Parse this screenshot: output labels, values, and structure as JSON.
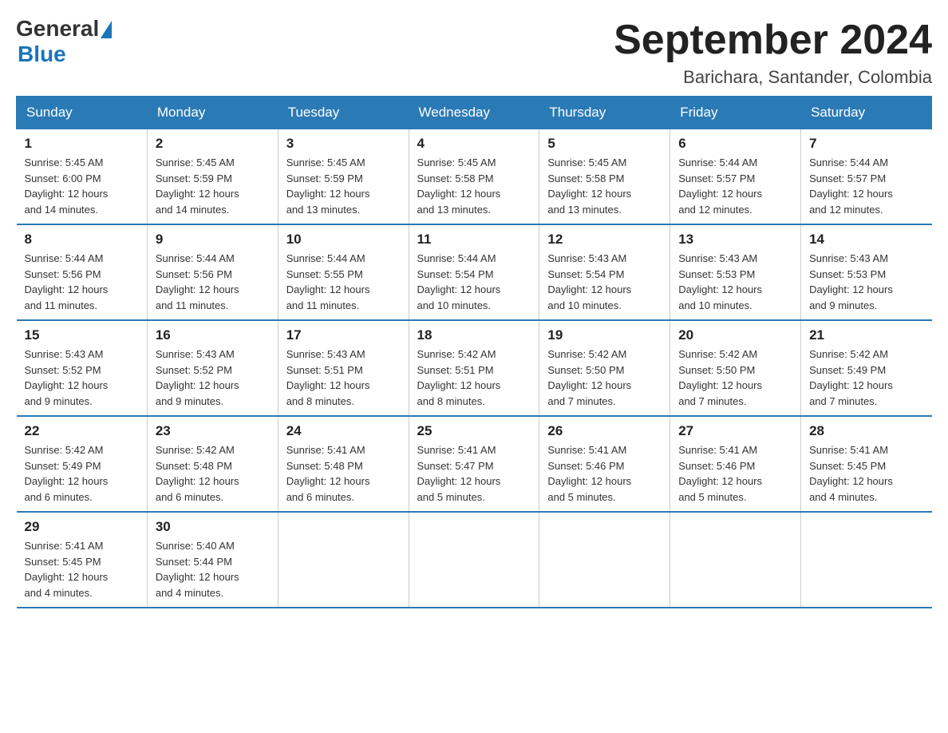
{
  "logo": {
    "general": "General",
    "blue": "Blue"
  },
  "header": {
    "title": "September 2024",
    "subtitle": "Barichara, Santander, Colombia"
  },
  "weekdays": [
    "Sunday",
    "Monday",
    "Tuesday",
    "Wednesday",
    "Thursday",
    "Friday",
    "Saturday"
  ],
  "weeks": [
    [
      {
        "day": "1",
        "sunrise": "5:45 AM",
        "sunset": "6:00 PM",
        "daylight": "12 hours and 14 minutes."
      },
      {
        "day": "2",
        "sunrise": "5:45 AM",
        "sunset": "5:59 PM",
        "daylight": "12 hours and 14 minutes."
      },
      {
        "day": "3",
        "sunrise": "5:45 AM",
        "sunset": "5:59 PM",
        "daylight": "12 hours and 13 minutes."
      },
      {
        "day": "4",
        "sunrise": "5:45 AM",
        "sunset": "5:58 PM",
        "daylight": "12 hours and 13 minutes."
      },
      {
        "day": "5",
        "sunrise": "5:45 AM",
        "sunset": "5:58 PM",
        "daylight": "12 hours and 13 minutes."
      },
      {
        "day": "6",
        "sunrise": "5:44 AM",
        "sunset": "5:57 PM",
        "daylight": "12 hours and 12 minutes."
      },
      {
        "day": "7",
        "sunrise": "5:44 AM",
        "sunset": "5:57 PM",
        "daylight": "12 hours and 12 minutes."
      }
    ],
    [
      {
        "day": "8",
        "sunrise": "5:44 AM",
        "sunset": "5:56 PM",
        "daylight": "12 hours and 11 minutes."
      },
      {
        "day": "9",
        "sunrise": "5:44 AM",
        "sunset": "5:56 PM",
        "daylight": "12 hours and 11 minutes."
      },
      {
        "day": "10",
        "sunrise": "5:44 AM",
        "sunset": "5:55 PM",
        "daylight": "12 hours and 11 minutes."
      },
      {
        "day": "11",
        "sunrise": "5:44 AM",
        "sunset": "5:54 PM",
        "daylight": "12 hours and 10 minutes."
      },
      {
        "day": "12",
        "sunrise": "5:43 AM",
        "sunset": "5:54 PM",
        "daylight": "12 hours and 10 minutes."
      },
      {
        "day": "13",
        "sunrise": "5:43 AM",
        "sunset": "5:53 PM",
        "daylight": "12 hours and 10 minutes."
      },
      {
        "day": "14",
        "sunrise": "5:43 AM",
        "sunset": "5:53 PM",
        "daylight": "12 hours and 9 minutes."
      }
    ],
    [
      {
        "day": "15",
        "sunrise": "5:43 AM",
        "sunset": "5:52 PM",
        "daylight": "12 hours and 9 minutes."
      },
      {
        "day": "16",
        "sunrise": "5:43 AM",
        "sunset": "5:52 PM",
        "daylight": "12 hours and 9 minutes."
      },
      {
        "day": "17",
        "sunrise": "5:43 AM",
        "sunset": "5:51 PM",
        "daylight": "12 hours and 8 minutes."
      },
      {
        "day": "18",
        "sunrise": "5:42 AM",
        "sunset": "5:51 PM",
        "daylight": "12 hours and 8 minutes."
      },
      {
        "day": "19",
        "sunrise": "5:42 AM",
        "sunset": "5:50 PM",
        "daylight": "12 hours and 7 minutes."
      },
      {
        "day": "20",
        "sunrise": "5:42 AM",
        "sunset": "5:50 PM",
        "daylight": "12 hours and 7 minutes."
      },
      {
        "day": "21",
        "sunrise": "5:42 AM",
        "sunset": "5:49 PM",
        "daylight": "12 hours and 7 minutes."
      }
    ],
    [
      {
        "day": "22",
        "sunrise": "5:42 AM",
        "sunset": "5:49 PM",
        "daylight": "12 hours and 6 minutes."
      },
      {
        "day": "23",
        "sunrise": "5:42 AM",
        "sunset": "5:48 PM",
        "daylight": "12 hours and 6 minutes."
      },
      {
        "day": "24",
        "sunrise": "5:41 AM",
        "sunset": "5:48 PM",
        "daylight": "12 hours and 6 minutes."
      },
      {
        "day": "25",
        "sunrise": "5:41 AM",
        "sunset": "5:47 PM",
        "daylight": "12 hours and 5 minutes."
      },
      {
        "day": "26",
        "sunrise": "5:41 AM",
        "sunset": "5:46 PM",
        "daylight": "12 hours and 5 minutes."
      },
      {
        "day": "27",
        "sunrise": "5:41 AM",
        "sunset": "5:46 PM",
        "daylight": "12 hours and 5 minutes."
      },
      {
        "day": "28",
        "sunrise": "5:41 AM",
        "sunset": "5:45 PM",
        "daylight": "12 hours and 4 minutes."
      }
    ],
    [
      {
        "day": "29",
        "sunrise": "5:41 AM",
        "sunset": "5:45 PM",
        "daylight": "12 hours and 4 minutes."
      },
      {
        "day": "30",
        "sunrise": "5:40 AM",
        "sunset": "5:44 PM",
        "daylight": "12 hours and 4 minutes."
      },
      null,
      null,
      null,
      null,
      null
    ]
  ],
  "labels": {
    "sunrise": "Sunrise:",
    "sunset": "Sunset:",
    "daylight": "Daylight:"
  }
}
